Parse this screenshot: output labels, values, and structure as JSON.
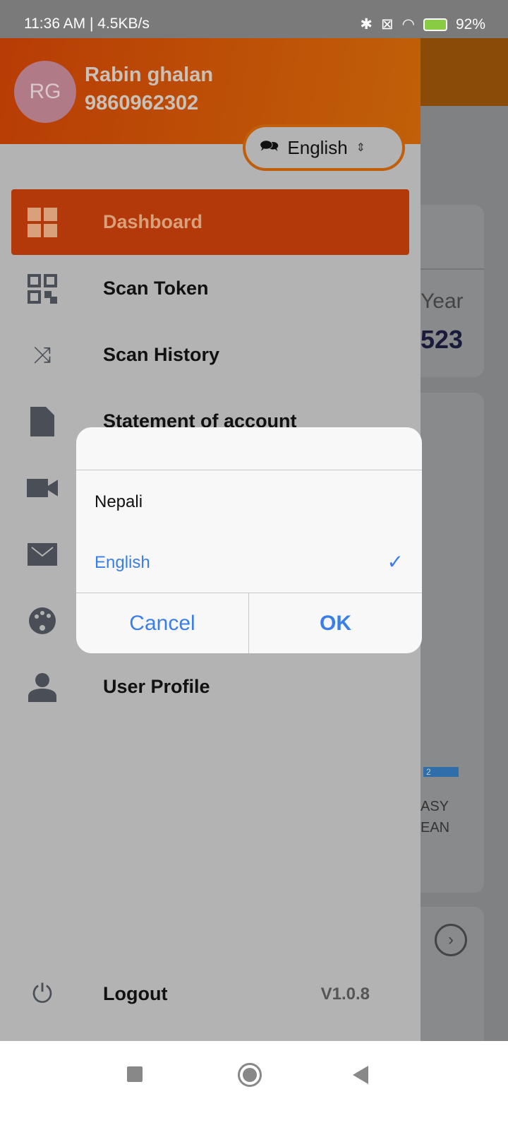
{
  "status_bar": {
    "time": "11:36 AM | 4.5KB/s",
    "battery": "92%"
  },
  "background": {
    "year_label": "Year",
    "year_value": "523",
    "bar_value": "2",
    "text1": "ASY",
    "text2": "EAN"
  },
  "drawer": {
    "user_initials": "RG",
    "user_name": "Rabin ghalan",
    "user_phone": "9860962302",
    "language": "English",
    "items": [
      {
        "label": "Dashboard",
        "icon": "dashboard-icon"
      },
      {
        "label": "Scan Token",
        "icon": "qr-code-icon"
      },
      {
        "label": "Scan History",
        "icon": "shuffle-icon"
      },
      {
        "label": "Statement of account",
        "icon": "document-icon"
      },
      {
        "label": "",
        "icon": "video-icon"
      },
      {
        "label": "",
        "icon": "mail-icon"
      },
      {
        "label": "",
        "icon": "palette-icon"
      },
      {
        "label": "User Profile",
        "icon": "user-icon"
      }
    ],
    "logout": "Logout",
    "version": "V1.0.8"
  },
  "dialog": {
    "options": [
      {
        "label": "Nepali",
        "selected": false
      },
      {
        "label": "English",
        "selected": true
      }
    ],
    "cancel": "Cancel",
    "ok": "OK",
    "accent": "#3a7ee8"
  }
}
